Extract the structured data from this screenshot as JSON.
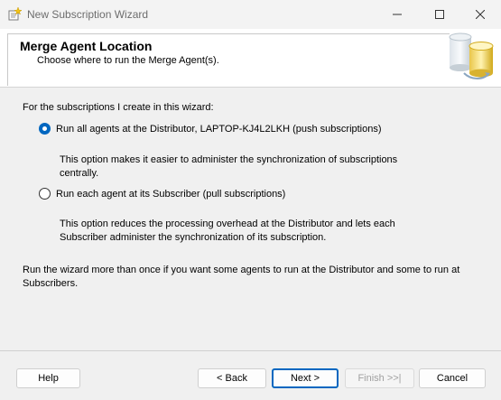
{
  "window": {
    "title": "New Subscription Wizard",
    "controls": [
      "minimize-icon",
      "maximize-icon",
      "close-icon"
    ]
  },
  "header": {
    "title": "Merge Agent Location",
    "subtitle": "Choose where to run the Merge Agent(s)."
  },
  "content": {
    "intro": "For the subscriptions I create in this wizard:",
    "options": [
      {
        "label": "Run all agents at the Distributor, LAPTOP-KJ4L2LKH (push subscriptions)",
        "description": "This option makes it easier to administer the synchronization of subscriptions centrally.",
        "selected": true
      },
      {
        "label": "Run each agent at its Subscriber (pull subscriptions)",
        "description": "This option reduces the processing overhead at the Distributor and lets each Subscriber administer the synchronization of its subscription.",
        "selected": false
      }
    ],
    "note": "Run the wizard more than once if you want some agents to run at the Distributor and some to run at Subscribers."
  },
  "buttons": {
    "help": "Help",
    "back": "< Back",
    "next": "Next >",
    "finish": "Finish >>|",
    "cancel": "Cancel"
  },
  "colors": {
    "accent": "#0067c0",
    "disabled_text": "#a0a0a0"
  }
}
